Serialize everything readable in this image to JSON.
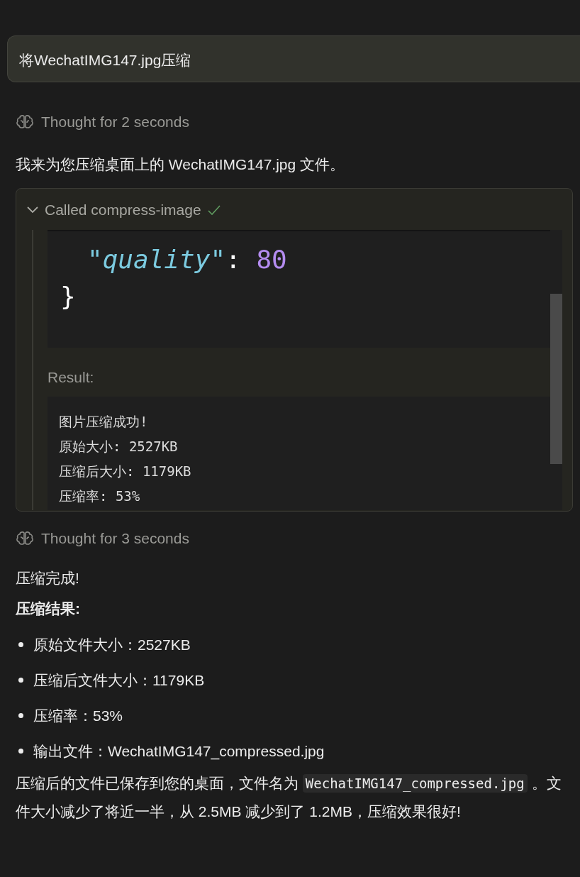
{
  "user_message": {
    "text": "将WechatIMG147.jpg压缩"
  },
  "thought_1": {
    "text": "Thought for 2 seconds"
  },
  "reply_1": {
    "text": "我来为您压缩桌面上的 WechatIMG147.jpg 文件。"
  },
  "tool_call": {
    "expanded": true,
    "title": "Called compress-image",
    "succeeded": true,
    "code_lines": [
      {
        "kind": "nested",
        "tokens": [
          {
            "kind": "key",
            "text": "\"quality\""
          },
          {
            "kind": "punct",
            "text": ": "
          },
          {
            "kind": "number",
            "text": "80"
          }
        ]
      },
      {
        "kind": "top",
        "tokens": [
          {
            "kind": "punct",
            "text": "}"
          }
        ]
      }
    ],
    "result_label": "Result:",
    "result_lines": [
      "图片压缩成功!",
      "原始大小: 2527KB",
      "压缩后大小: 1179KB",
      "压缩率: 53%"
    ]
  },
  "thought_2": {
    "text": "Thought for 3 seconds"
  },
  "reply_2": {
    "intro": "压缩完成!",
    "heading": "压缩结果:",
    "bullets": [
      "原始文件大小：2527KB",
      "压缩后文件大小：1179KB",
      "压缩率：53%",
      "输出文件：WechatIMG147_compressed.jpg"
    ],
    "paragraph": [
      {
        "kind": "text",
        "text": "压缩后的文件已保存到您的桌面，文件名为 "
      },
      {
        "kind": "code",
        "text": "WechatIMG147_compressed.jpg"
      },
      {
        "kind": "text",
        "text": " 。文件大小减少了将近一半，从 2.5MB 减少到了 1.2MB，压缩效果很好!"
      }
    ]
  }
}
